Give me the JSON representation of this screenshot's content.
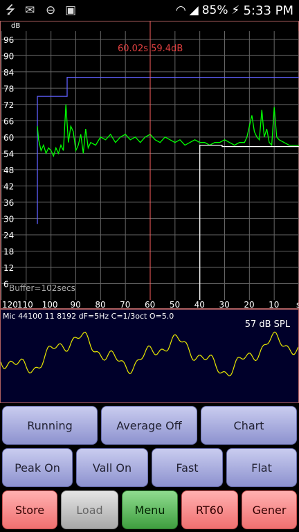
{
  "status_bar": {
    "icons": [
      "usb-icon",
      "mail-icon",
      "block-icon",
      "briefcase-icon",
      "wifi-icon",
      "signal-icon",
      "battery-charging-icon"
    ],
    "battery": "85%",
    "time": "5:33 PM"
  },
  "chart": {
    "y_unit": "dB",
    "y_ticks": [
      "96",
      "90",
      "84",
      "78",
      "72",
      "66",
      "60",
      "54",
      "48",
      "42",
      "36",
      "30",
      "24",
      "18",
      "12",
      "6"
    ],
    "x_ticks": [
      "120",
      "110",
      "100",
      "90",
      "80",
      "70",
      "60",
      "50",
      "40",
      "30",
      "20",
      "10",
      "s"
    ],
    "cursor_readout": "60.02s  59.4dB",
    "buffer_label": "Buffer=102secs",
    "colors": {
      "peak": "#6060ff",
      "level": "#00ff00",
      "valley": "#ffffff",
      "cursor": "#ff6060",
      "grid": "#666666"
    }
  },
  "chart_data": {
    "type": "line",
    "xlabel": "",
    "ylabel": "dB",
    "xlim": [
      120,
      0
    ],
    "ylim": [
      0,
      99
    ],
    "series": [
      {
        "x": [
          120,
          105.5,
          105.5,
          93.5,
          93.5,
          0
        ],
        "values": [
          null,
          28,
          75,
          75,
          82,
          82
        ]
      },
      {
        "x": [
          105.5,
          105,
          104,
          103,
          102,
          101,
          100,
          99,
          98,
          97,
          96,
          95,
          94,
          93,
          92,
          91,
          90,
          89,
          88,
          87,
          86,
          85,
          84,
          82,
          80,
          78,
          76,
          74,
          72,
          70,
          68,
          66,
          64,
          62,
          60,
          58,
          56,
          54,
          52,
          50,
          48,
          46,
          44,
          42,
          40,
          38,
          36,
          34,
          32,
          30,
          28,
          26,
          24,
          22,
          21,
          20,
          19,
          18,
          17,
          16,
          15,
          14,
          13,
          12,
          11,
          10,
          9,
          8,
          6,
          4,
          2,
          0
        ],
        "values": [
          64,
          59,
          55,
          57,
          54,
          56,
          55,
          53,
          56,
          54,
          57,
          55,
          72,
          58,
          64,
          62,
          55,
          57,
          61,
          54,
          63,
          56,
          58,
          57,
          60,
          59,
          61,
          58,
          60,
          61,
          59,
          60,
          58,
          60,
          61,
          59,
          58,
          60,
          59,
          58,
          59,
          57,
          58,
          59,
          58,
          58,
          57,
          58,
          58,
          59,
          58,
          57,
          58,
          58,
          60,
          64,
          68,
          62,
          60,
          59,
          70,
          60,
          63,
          58,
          57,
          71,
          60,
          59,
          58,
          57,
          57,
          57
        ]
      },
      {
        "x": [
          40,
          40,
          31,
          31,
          0
        ],
        "values": [
          0,
          57,
          57,
          56.5,
          56.5
        ]
      }
    ],
    "grid": true
  },
  "waveform": {
    "config": "Mic 44100 11 8192 dF=5Hz C=1/3oct O=5.0",
    "spl": "57 dB SPL",
    "color": "#e8e800"
  },
  "buttons": {
    "running": "Running",
    "average": "Average Off",
    "chart": "Chart",
    "peak": "Peak On",
    "valley": "Vall On",
    "speed": "Fast",
    "weighting": "Flat",
    "store": "Store",
    "load": "Load",
    "menu": "Menu",
    "rt60": "RT60",
    "generator": "Gener"
  }
}
